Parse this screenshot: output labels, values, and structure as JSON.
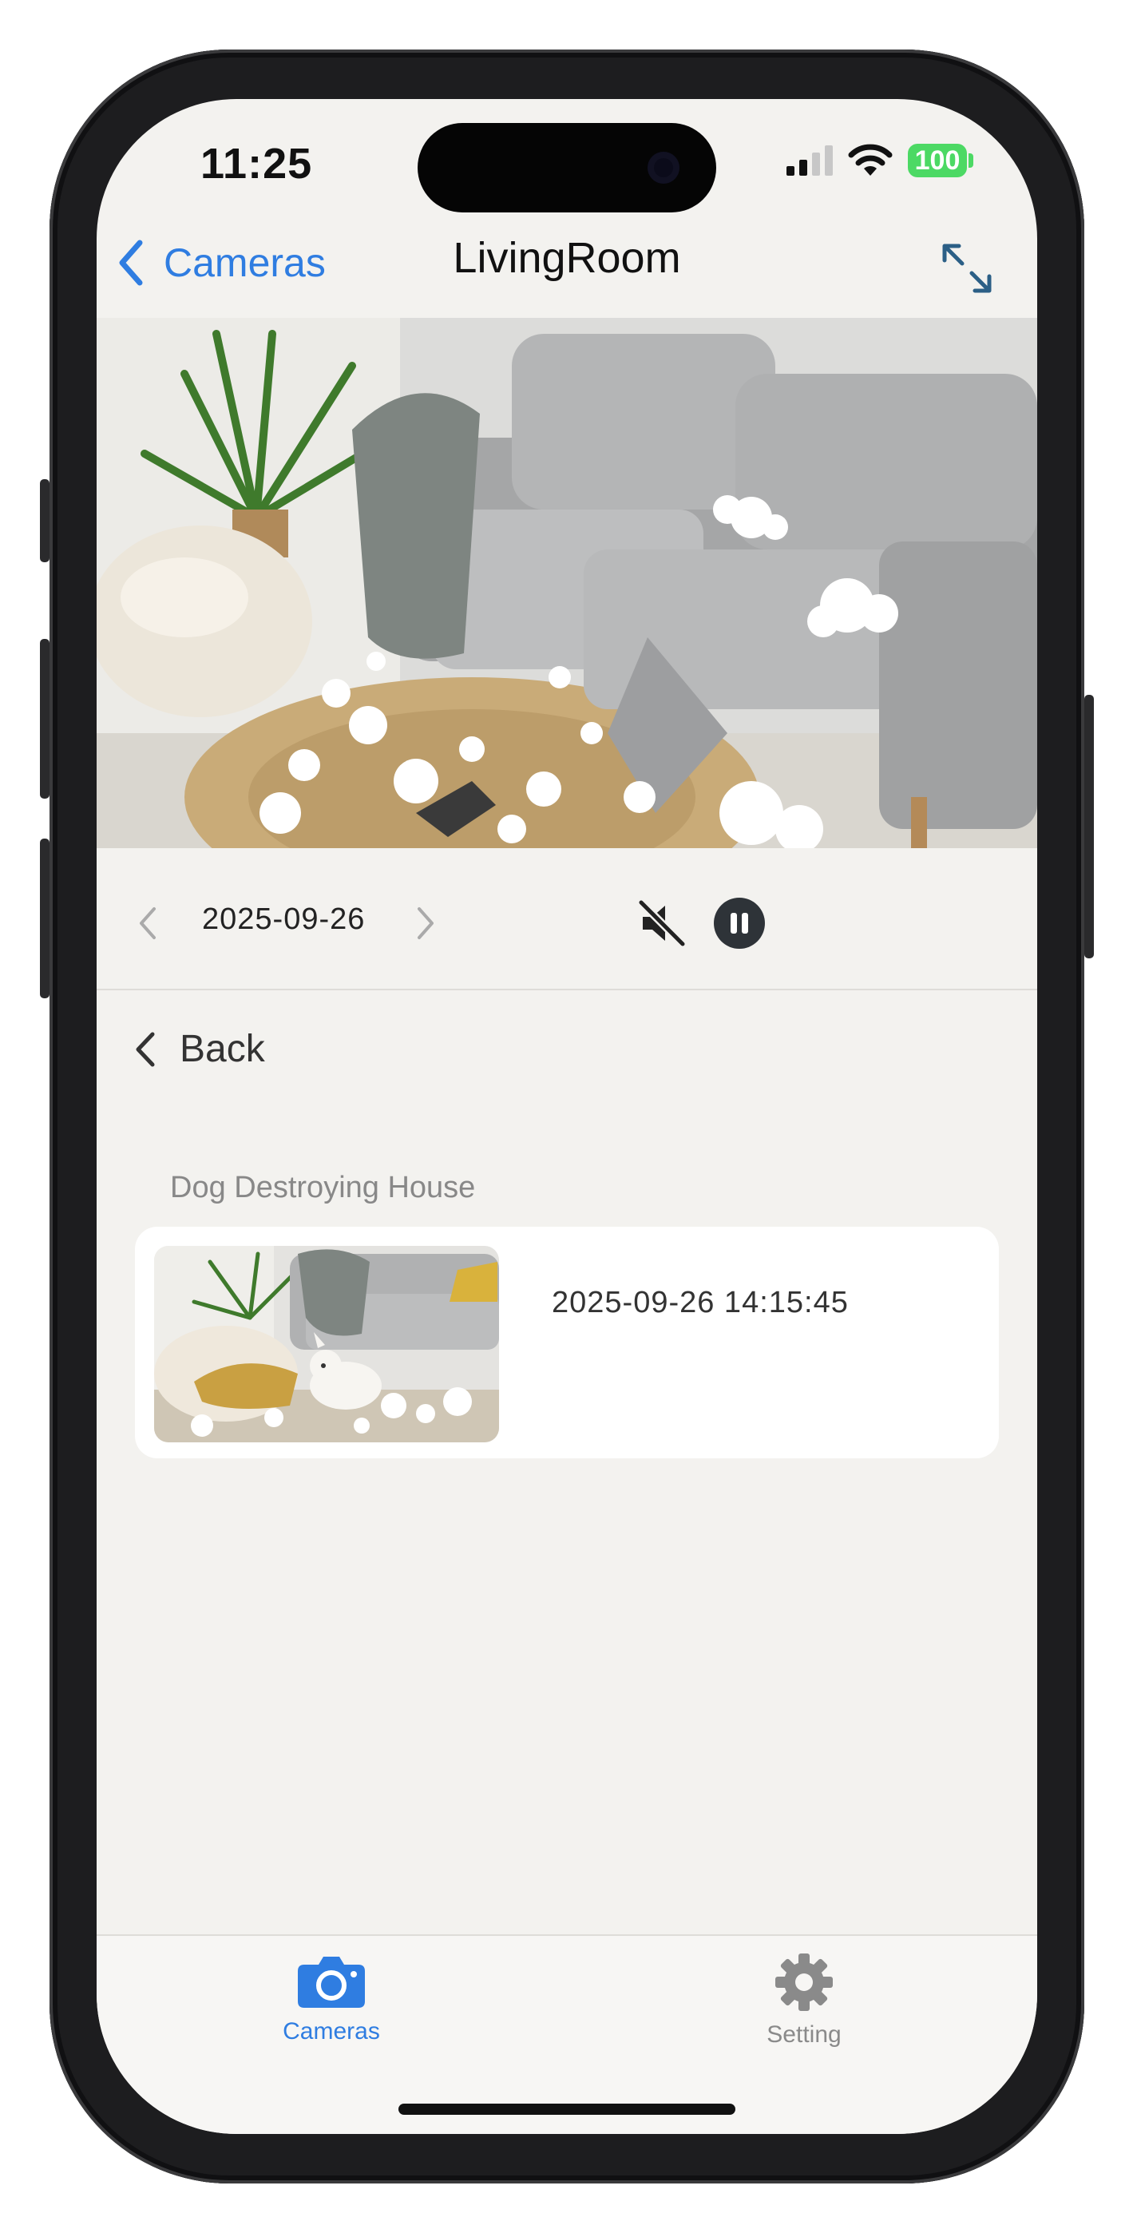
{
  "status_bar": {
    "time": "11:25",
    "battery": "100"
  },
  "nav": {
    "back_label": "Cameras",
    "title": "LivingRoom"
  },
  "playback": {
    "date": "2025-09-26",
    "muted": true
  },
  "events": {
    "back_label": "Back",
    "title": "Dog Destroying House",
    "items": [
      {
        "timestamp": "2025-09-26 14:15:45"
      }
    ]
  },
  "tabbar": {
    "tabs": [
      {
        "label": "Cameras",
        "active": true,
        "icon": "camera-icon"
      },
      {
        "label": "Setting",
        "active": false,
        "icon": "gear-icon"
      }
    ]
  },
  "colors": {
    "accent": "#2f7de1",
    "inactive": "#8a8a8a",
    "background": "#f3f2ef"
  }
}
